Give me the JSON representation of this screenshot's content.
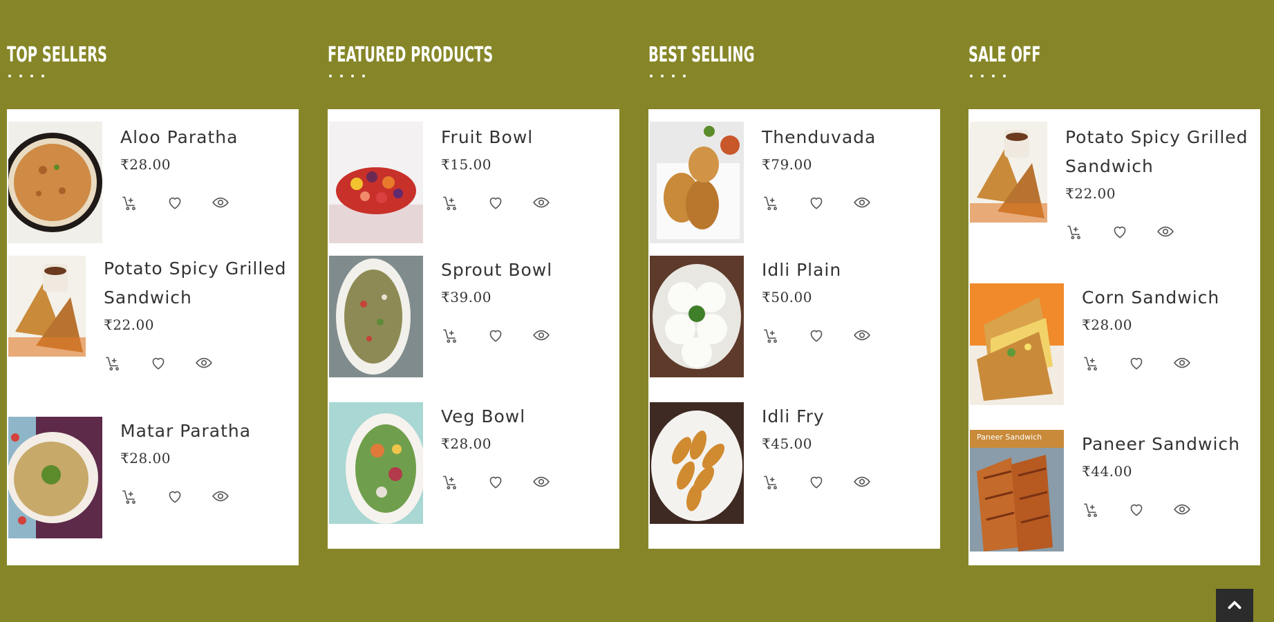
{
  "columns": [
    {
      "title": "TOP SELLERS",
      "products": [
        {
          "name_lines": [
            "Aloo Paratha"
          ],
          "price": "₹28.00",
          "image": "aloo-paratha-image"
        },
        {
          "name_lines": [
            "Potato Spicy Grilled",
            "Sandwich"
          ],
          "price": "₹22.00",
          "image": "potato-sandwich-image"
        },
        {
          "name_lines": [
            "Matar Paratha"
          ],
          "price": "₹28.00",
          "image": "matar-paratha-image"
        }
      ]
    },
    {
      "title": "FEATURED PRODUCTS",
      "products": [
        {
          "name_lines": [
            "Fruit Bowl"
          ],
          "price": "₹15.00",
          "image": "fruit-bowl-image"
        },
        {
          "name_lines": [
            "Sprout Bowl"
          ],
          "price": "₹39.00",
          "image": "sprout-bowl-image"
        },
        {
          "name_lines": [
            "Veg Bowl"
          ],
          "price": "₹28.00",
          "image": "veg-bowl-image"
        }
      ]
    },
    {
      "title": "BEST SELLING",
      "products": [
        {
          "name_lines": [
            "Thenduvada"
          ],
          "price": "₹79.00",
          "image": "thenduvada-image"
        },
        {
          "name_lines": [
            "Idli Plain"
          ],
          "price": "₹50.00",
          "image": "idli-plain-image"
        },
        {
          "name_lines": [
            "Idli Fry"
          ],
          "price": "₹45.00",
          "image": "idli-fry-image"
        }
      ]
    },
    {
      "title": "SALE OFF",
      "products": [
        {
          "name_lines": [
            "Potato Spicy Grilled",
            "Sandwich"
          ],
          "price": "₹22.00",
          "image": "potato-sandwich-image"
        },
        {
          "name_lines": [
            "Corn Sandwich"
          ],
          "price": "₹28.00",
          "image": "corn-sandwich-image"
        },
        {
          "name_lines": [
            "Paneer Sandwich"
          ],
          "price": "₹44.00",
          "image": "paneer-sandwich-image",
          "image_caption": "Paneer Sandwich"
        }
      ]
    }
  ],
  "actions": {
    "add_to_cart_icon": "cart-plus-icon",
    "wishlist_icon": "heart-icon",
    "quick_view_icon": "eye-icon"
  },
  "scroll_top": {
    "icon": "chevron-up-icon"
  },
  "colors": {
    "background": "#868628",
    "card": "#ffffff",
    "text": "#333333",
    "scroll_button": "#2b2b2b"
  }
}
